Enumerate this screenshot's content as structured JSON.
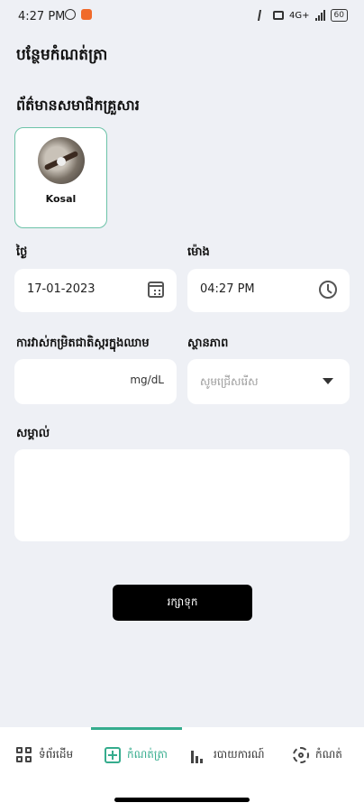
{
  "status_bar": {
    "time": "4:27 PM",
    "network": "4G+",
    "battery": "60"
  },
  "page_title": "បន្ថែមកំណត់ត្រា",
  "member_section": {
    "title": "ព័ត៌មានសមាជិកគ្រួសារ",
    "member": {
      "name": "Kosal"
    }
  },
  "form": {
    "date": {
      "label": "ថ្ងៃ",
      "value": "17-01-2023"
    },
    "time": {
      "label": "ម៉ោង",
      "value": "04:27 PM"
    },
    "glucose": {
      "label": "ការវាស់កម្រិតជាតិស្ករក្នុងឈាម",
      "value": "",
      "unit": "mg/dL"
    },
    "status": {
      "label": "ស្ថានភាព",
      "placeholder": "សូមជ្រើសរើស"
    },
    "note": {
      "label": "សម្គាល់",
      "value": ""
    }
  },
  "save_label": "រក្សាទុក",
  "nav": {
    "items": [
      {
        "label": "ទំព័រដើម",
        "icon": "home-grid-icon",
        "active": false
      },
      {
        "label": "កំណត់ត្រា",
        "icon": "add-record-icon",
        "active": true
      },
      {
        "label": "របាយការណ៍",
        "icon": "bar-chart-icon",
        "active": false
      },
      {
        "label": "កំណត់",
        "icon": "gear-icon",
        "active": false
      }
    ]
  },
  "colors": {
    "accent": "#35ac8d",
    "background": "#eef0f5",
    "button": "#000000"
  }
}
